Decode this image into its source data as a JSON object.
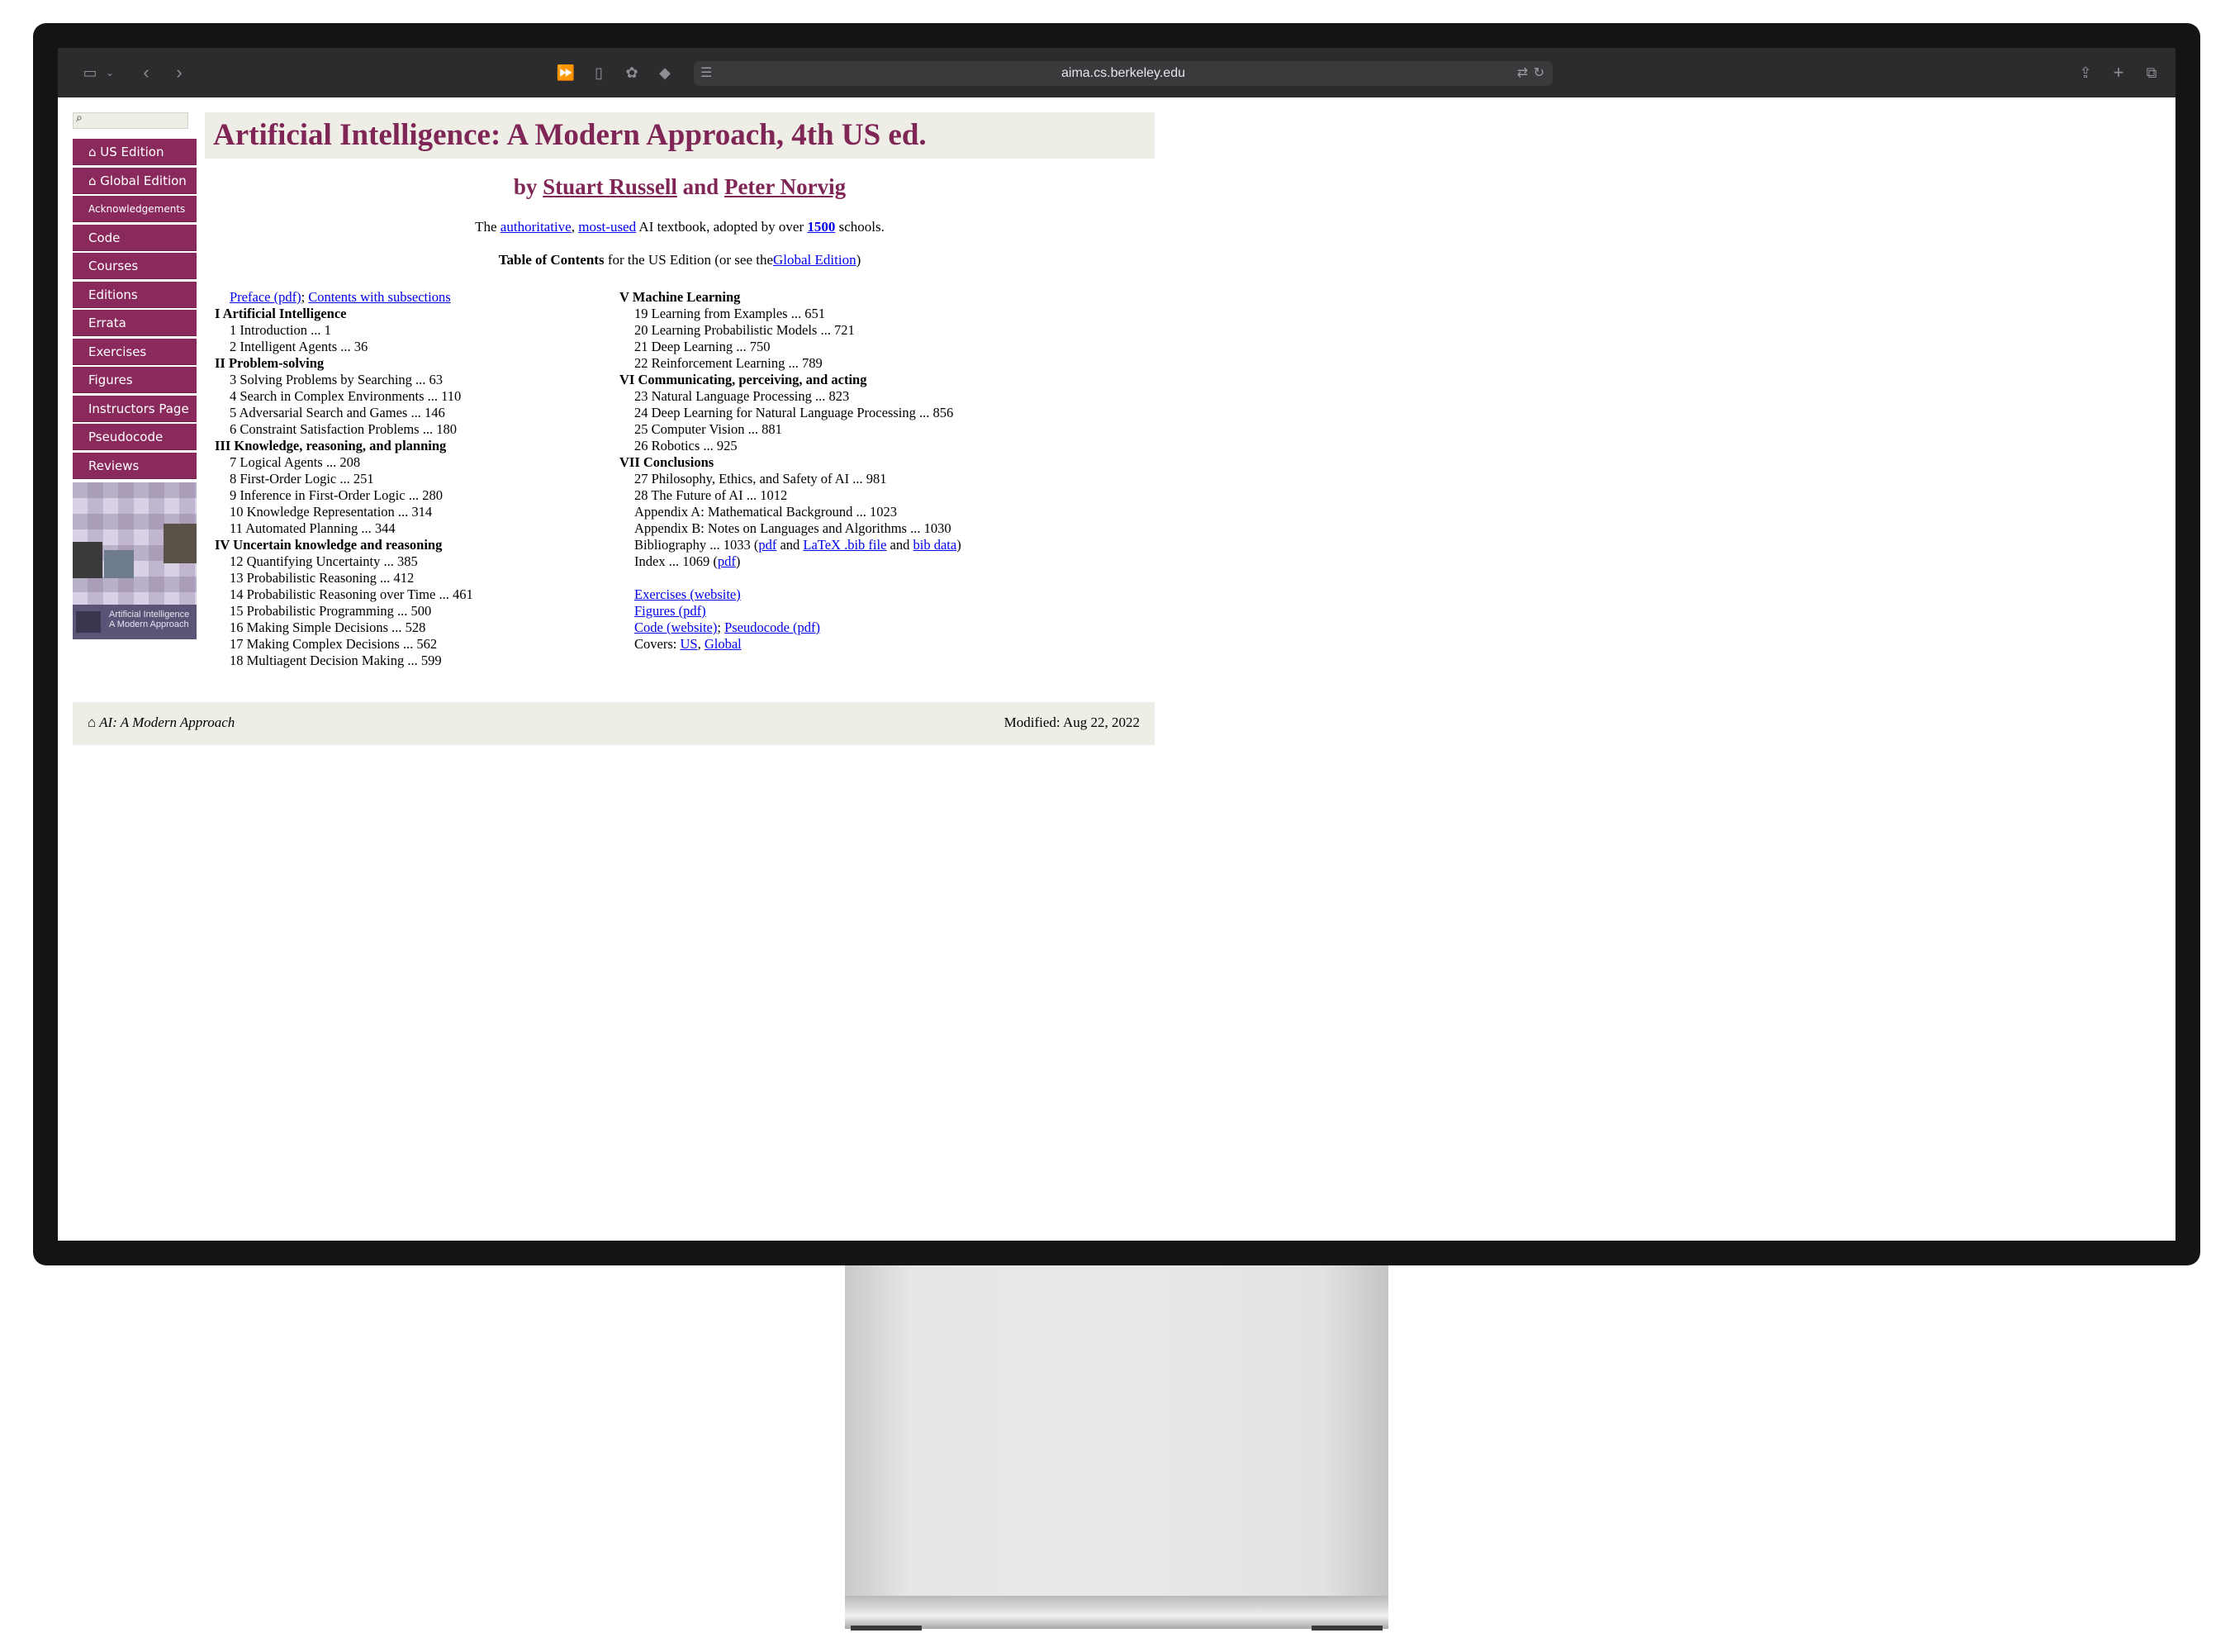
{
  "browser": {
    "url": "aima.cs.berkeley.edu",
    "icons": {
      "sidebar": "sidebar-icon",
      "back": "chevron-left-icon",
      "forward": "chevron-right-icon",
      "reader": "reader-icon",
      "page": "page-icon",
      "extension": "extension-icon",
      "shield": "shield-icon",
      "translate": "translate-icon",
      "reload": "reload-icon",
      "share": "share-icon",
      "new_tab": "plus-icon",
      "tabs": "tabs-icon"
    }
  },
  "sidebar": {
    "search_placeholder": "",
    "items": [
      {
        "label": "⌂ US Edition"
      },
      {
        "label": "⌂ Global Edition"
      },
      {
        "label": "Acknowledgements"
      },
      {
        "label": "Code"
      },
      {
        "label": "Courses"
      },
      {
        "label": "Editions"
      },
      {
        "label": "Errata"
      },
      {
        "label": "Exercises"
      },
      {
        "label": "Figures"
      },
      {
        "label": "Instructors Page"
      },
      {
        "label": "Pseudocode"
      },
      {
        "label": "Reviews"
      }
    ],
    "cover_text": "Artificial Intelligence A Modern Approach"
  },
  "header": {
    "title": "Artificial Intelligence: A Modern Approach, 4th US ed.",
    "by": "by",
    "author1": "Stuart Russell",
    "and": "and",
    "author2": "Peter Norvig",
    "tag_the": "The",
    "tag_authoritative": "authoritative",
    "tag_comma": ",",
    "tag_mostused": "most-used",
    "tag_mid": "AI textbook, adopted by over",
    "tag_count": "1500",
    "tag_end": "schools.",
    "toc_bold": "Table of Contents",
    "toc_mid": "for the US Edition (or see the",
    "toc_link": "Global Edition",
    "toc_end": ")"
  },
  "toc_left": {
    "preface": "Preface (pdf)",
    "sep": ";",
    "contents": "Contents with subsections",
    "rows": [
      {
        "text": "I Artificial Intelligence",
        "part": true
      },
      {
        "text": "1 Introduction ... 1"
      },
      {
        "text": "2 Intelligent Agents ... 36"
      },
      {
        "text": "II Problem-solving",
        "part": true
      },
      {
        "text": "3 Solving Problems by Searching ... 63"
      },
      {
        "text": "4 Search in Complex Environments ... 110"
      },
      {
        "text": "5 Adversarial Search and Games ... 146"
      },
      {
        "text": "6 Constraint Satisfaction Problems ... 180"
      },
      {
        "text": "III Knowledge, reasoning, and planning",
        "part": true
      },
      {
        "text": "7 Logical Agents ... 208"
      },
      {
        "text": "8 First-Order Logic ... 251"
      },
      {
        "text": "9 Inference in First-Order Logic ... 280"
      },
      {
        "text": "10 Knowledge Representation ... 314"
      },
      {
        "text": "11 Automated Planning ... 344"
      },
      {
        "text": "IV Uncertain knowledge and reasoning",
        "part": true
      },
      {
        "text": "12 Quantifying Uncertainty ... 385"
      },
      {
        "text": "13 Probabilistic Reasoning ... 412"
      },
      {
        "text": "14 Probabilistic Reasoning over Time ... 461"
      },
      {
        "text": "15 Probabilistic Programming ... 500"
      },
      {
        "text": "16 Making Simple Decisions ... 528"
      },
      {
        "text": "17 Making Complex Decisions ... 562"
      },
      {
        "text": "18 Multiagent Decision Making ... 599"
      }
    ]
  },
  "toc_right": {
    "rows": [
      {
        "text": "V Machine Learning",
        "part": true
      },
      {
        "text": "19 Learning from Examples ... 651"
      },
      {
        "text": "20 Learning Probabilistic Models ... 721"
      },
      {
        "text": "21 Deep Learning ... 750"
      },
      {
        "text": "22 Reinforcement Learning ... 789"
      },
      {
        "text": "VI Communicating, perceiving, and acting",
        "part": true
      },
      {
        "text": "23 Natural Language Processing ... 823"
      },
      {
        "text": "24 Deep Learning for Natural Language Processing ... 856"
      },
      {
        "text": "25 Computer Vision ... 881"
      },
      {
        "text": "26 Robotics ... 925"
      },
      {
        "text": "VII Conclusions",
        "part": true
      },
      {
        "text": "27 Philosophy, Ethics, and Safety of AI ... 981"
      },
      {
        "text": "28 The Future of AI ... 1012"
      },
      {
        "text": "Appendix A: Mathematical Background ... 1023"
      },
      {
        "text": "Appendix B: Notes on Languages and Algorithms ... 1030"
      }
    ],
    "biblio_pre": "Bibliography ... 1033 (",
    "biblio_pdf": "pdf",
    "biblio_and1": "and",
    "biblio_bib": "LaTeX .bib file",
    "biblio_and2": "and",
    "biblio_data": "bib data",
    "biblio_end": ")",
    "index_pre": "Index ... 1069 (",
    "index_pdf": "pdf",
    "index_end": ")",
    "exercises": "Exercises (website)",
    "figures": "Figures (pdf)",
    "code": "Code (website)",
    "code_sep": ";",
    "pseudocode": "Pseudocode (pdf)",
    "covers_label": "Covers:",
    "cover_us": "US",
    "cover_comma": ",",
    "cover_global": "Global"
  },
  "footer": {
    "home": "⌂ AI: A Modern Approach",
    "modified": "Modified: Aug 22, 2022"
  }
}
